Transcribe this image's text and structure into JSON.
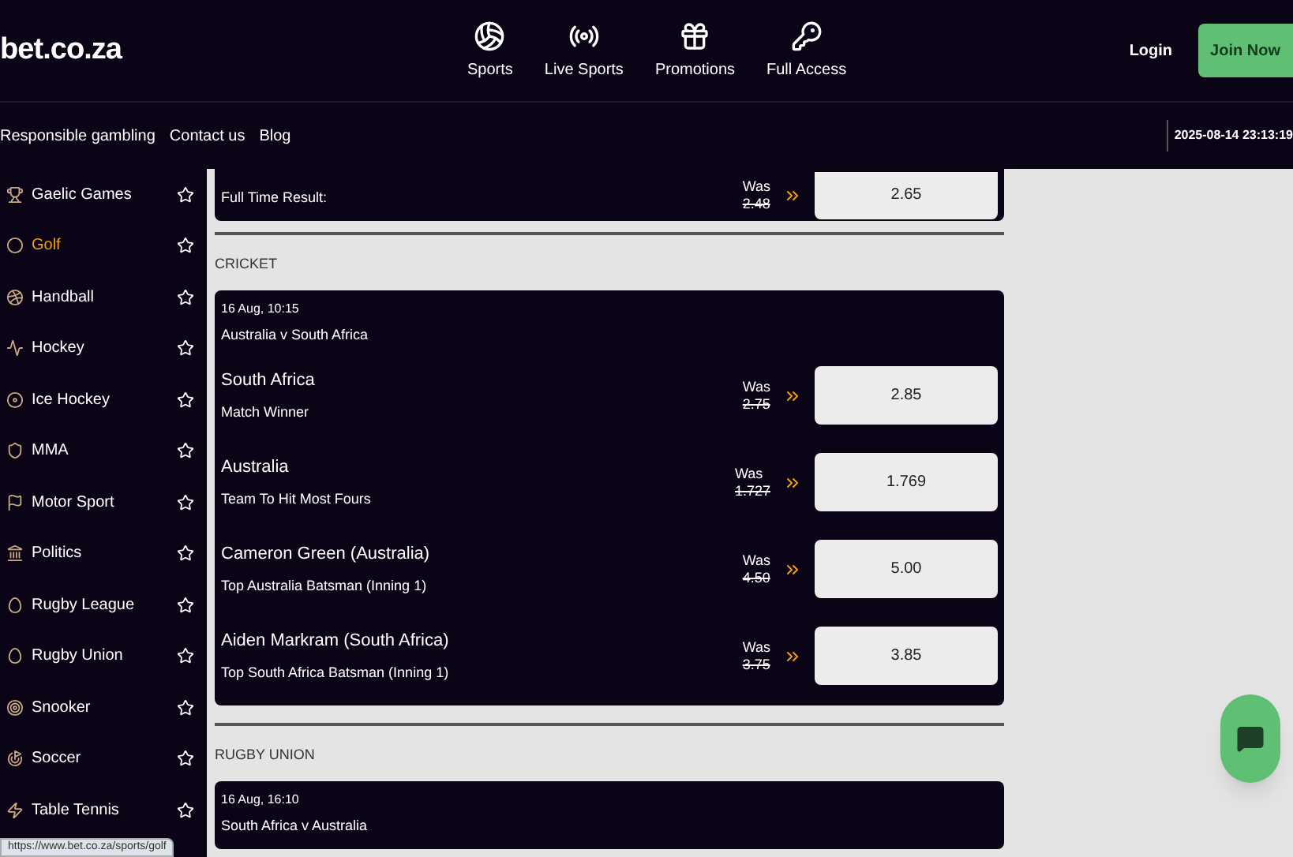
{
  "header": {
    "logo": "bet.co.za",
    "nav": [
      {
        "label": "Sports",
        "selected": false
      },
      {
        "label": "Live Sports",
        "selected": false
      },
      {
        "label": "Promotions",
        "selected": false
      },
      {
        "label": "Full Access",
        "selected": false
      }
    ],
    "login": "Login",
    "join": "Join Now"
  },
  "subnav": {
    "links": [
      "Responsible gambling",
      "Contact us",
      "Blog"
    ],
    "datetime": "2025-08-14 23:13:19"
  },
  "sidebar": {
    "items": [
      {
        "label": "Gaelic Games",
        "selected": false
      },
      {
        "label": "Golf",
        "selected": true
      },
      {
        "label": "Handball",
        "selected": false
      },
      {
        "label": "Hockey",
        "selected": false
      },
      {
        "label": "Ice Hockey",
        "selected": false
      },
      {
        "label": "MMA",
        "selected": false
      },
      {
        "label": "Motor Sport",
        "selected": false
      },
      {
        "label": "Politics",
        "selected": false
      },
      {
        "label": "Rugby League",
        "selected": false
      },
      {
        "label": "Rugby Union",
        "selected": false
      },
      {
        "label": "Snooker",
        "selected": false
      },
      {
        "label": "Soccer",
        "selected": false
      },
      {
        "label": "Table Tennis",
        "selected": false
      }
    ]
  },
  "top_card": {
    "rows": [
      {
        "selection": "Full Time Result:",
        "was_label": "Was",
        "was": "2.48",
        "odds": "2.65"
      }
    ]
  },
  "sections": [
    {
      "title": "CRICKET",
      "events": [
        {
          "time": "16 Aug, 10:15",
          "match": "Australia v South Africa",
          "rows": [
            {
              "selection": "South Africa",
              "market": "Match Winner",
              "was_label": "Was",
              "was": "2.75",
              "odds": "2.85"
            },
            {
              "selection": "Australia",
              "market": "Team To Hit Most Fours",
              "was_label": "Was",
              "was": "1.727",
              "odds": "1.769"
            },
            {
              "selection": "Cameron Green (Australia)",
              "market": "Top Australia Batsman (Inning 1)",
              "was_label": "Was",
              "was": "4.50",
              "odds": "5.00"
            },
            {
              "selection": "Aiden Markram (South Africa)",
              "market": "Top South Africa Batsman (Inning 1)",
              "was_label": "Was",
              "was": "3.75",
              "odds": "3.85"
            }
          ]
        }
      ]
    },
    {
      "title": "RUGBY UNION",
      "events": [
        {
          "time": "16 Aug, 16:10",
          "match": "South Africa v Australia"
        }
      ]
    }
  ],
  "status_url": "https://www.bet.co.za/sports/golf"
}
